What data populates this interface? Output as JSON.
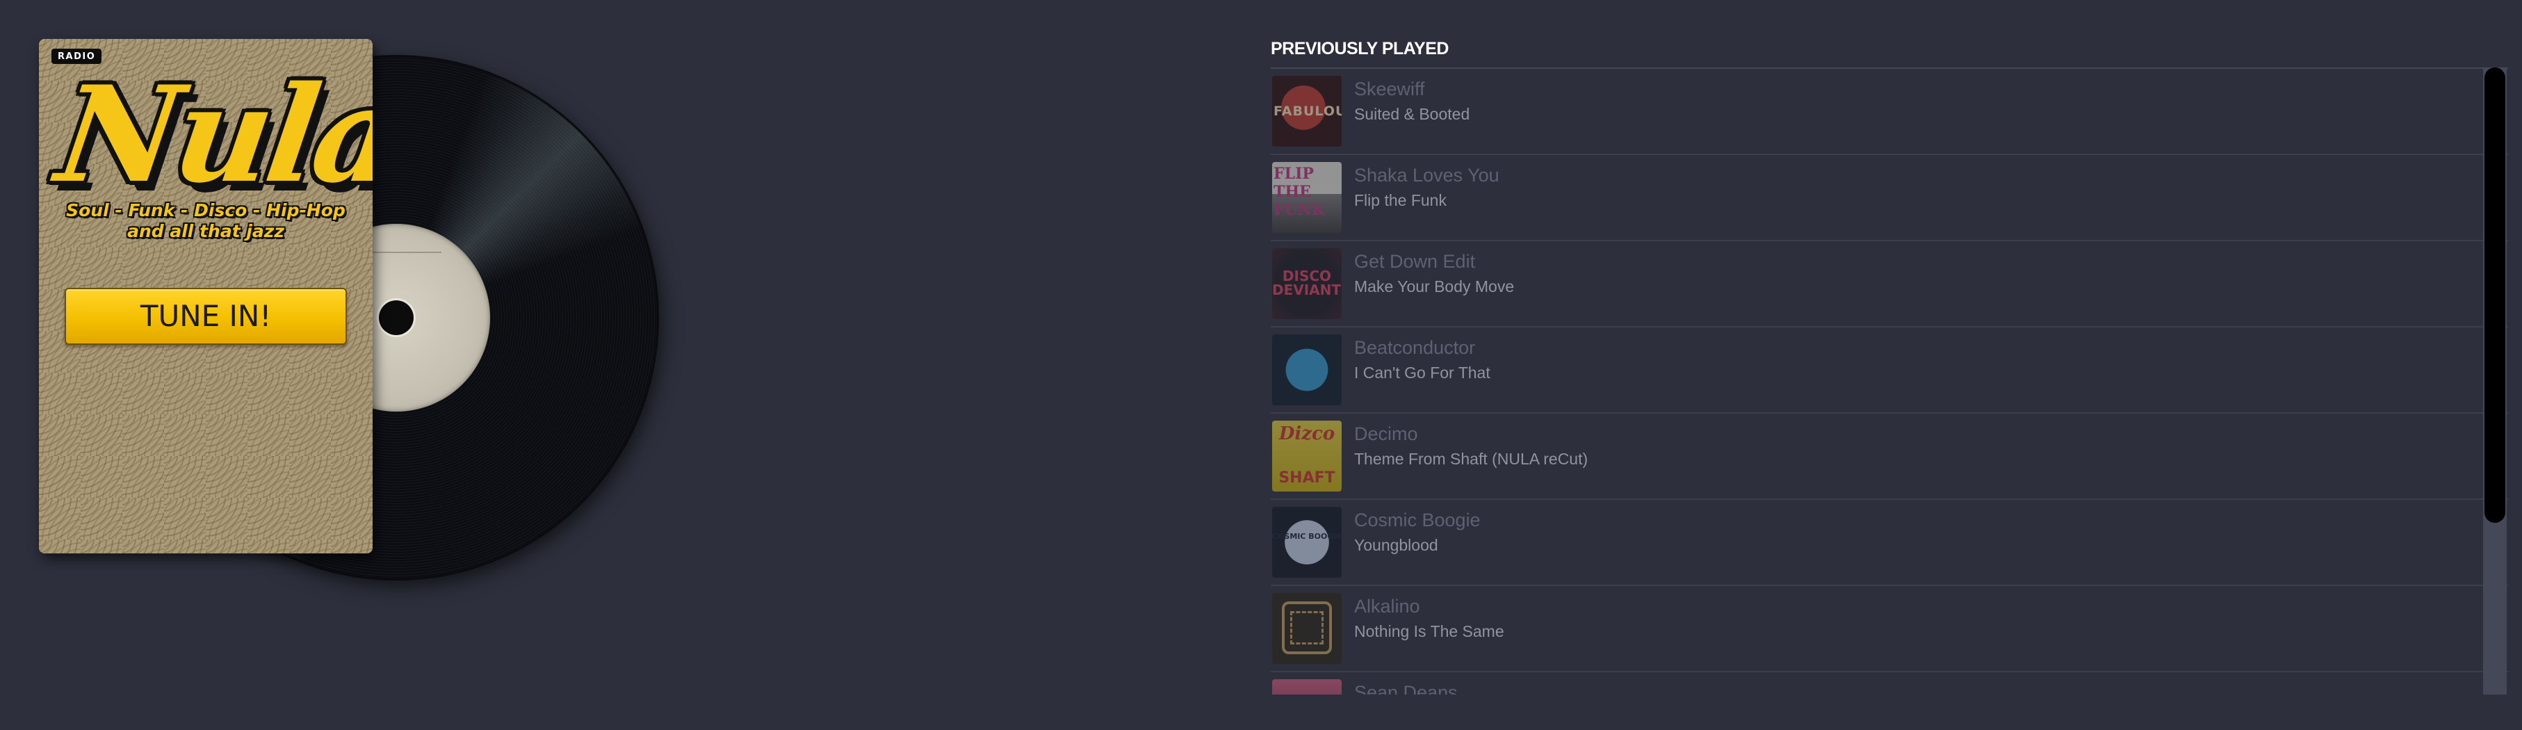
{
  "player": {
    "badge": "RADIO",
    "logo": "Nula",
    "tagline_line1": "Soul - Funk - Disco - Hip-Hop",
    "tagline_line2": "and all that jazz",
    "tune_in_label": "TUNE IN!",
    "brand_color": "#f5c518"
  },
  "history": {
    "title": "PREVIOUSLY PLAYED",
    "tracks": [
      {
        "artist": "Skeewiff",
        "title": "Suited & Booted",
        "cover_text": "FABULOUS"
      },
      {
        "artist": "Shaka Loves You",
        "title": "Flip the Funk",
        "cover_text": "FLIP THE FUNK"
      },
      {
        "artist": "Get Down Edit",
        "title": "Make Your Body Move",
        "cover_text": "DISCO DEVIANTS"
      },
      {
        "artist": "Beatconductor",
        "title": "I Can't Go For That",
        "cover_text": ""
      },
      {
        "artist": "Decimo",
        "title": "Theme From Shaft (NULA reCut)",
        "cover_text": "Dizco",
        "cover_text2": "SHAFT"
      },
      {
        "artist": "Cosmic Boogie",
        "title": "Youngblood",
        "cover_text": "COSMIC BOOGIE"
      },
      {
        "artist": "Alkalino",
        "title": "Nothing Is The Same",
        "cover_text": ""
      },
      {
        "artist": "Sean Deans",
        "title": "",
        "cover_text": ""
      }
    ]
  },
  "colors": {
    "background": "#2d303c",
    "artist_text": "#5d6170",
    "title_text": "#9094a0"
  }
}
